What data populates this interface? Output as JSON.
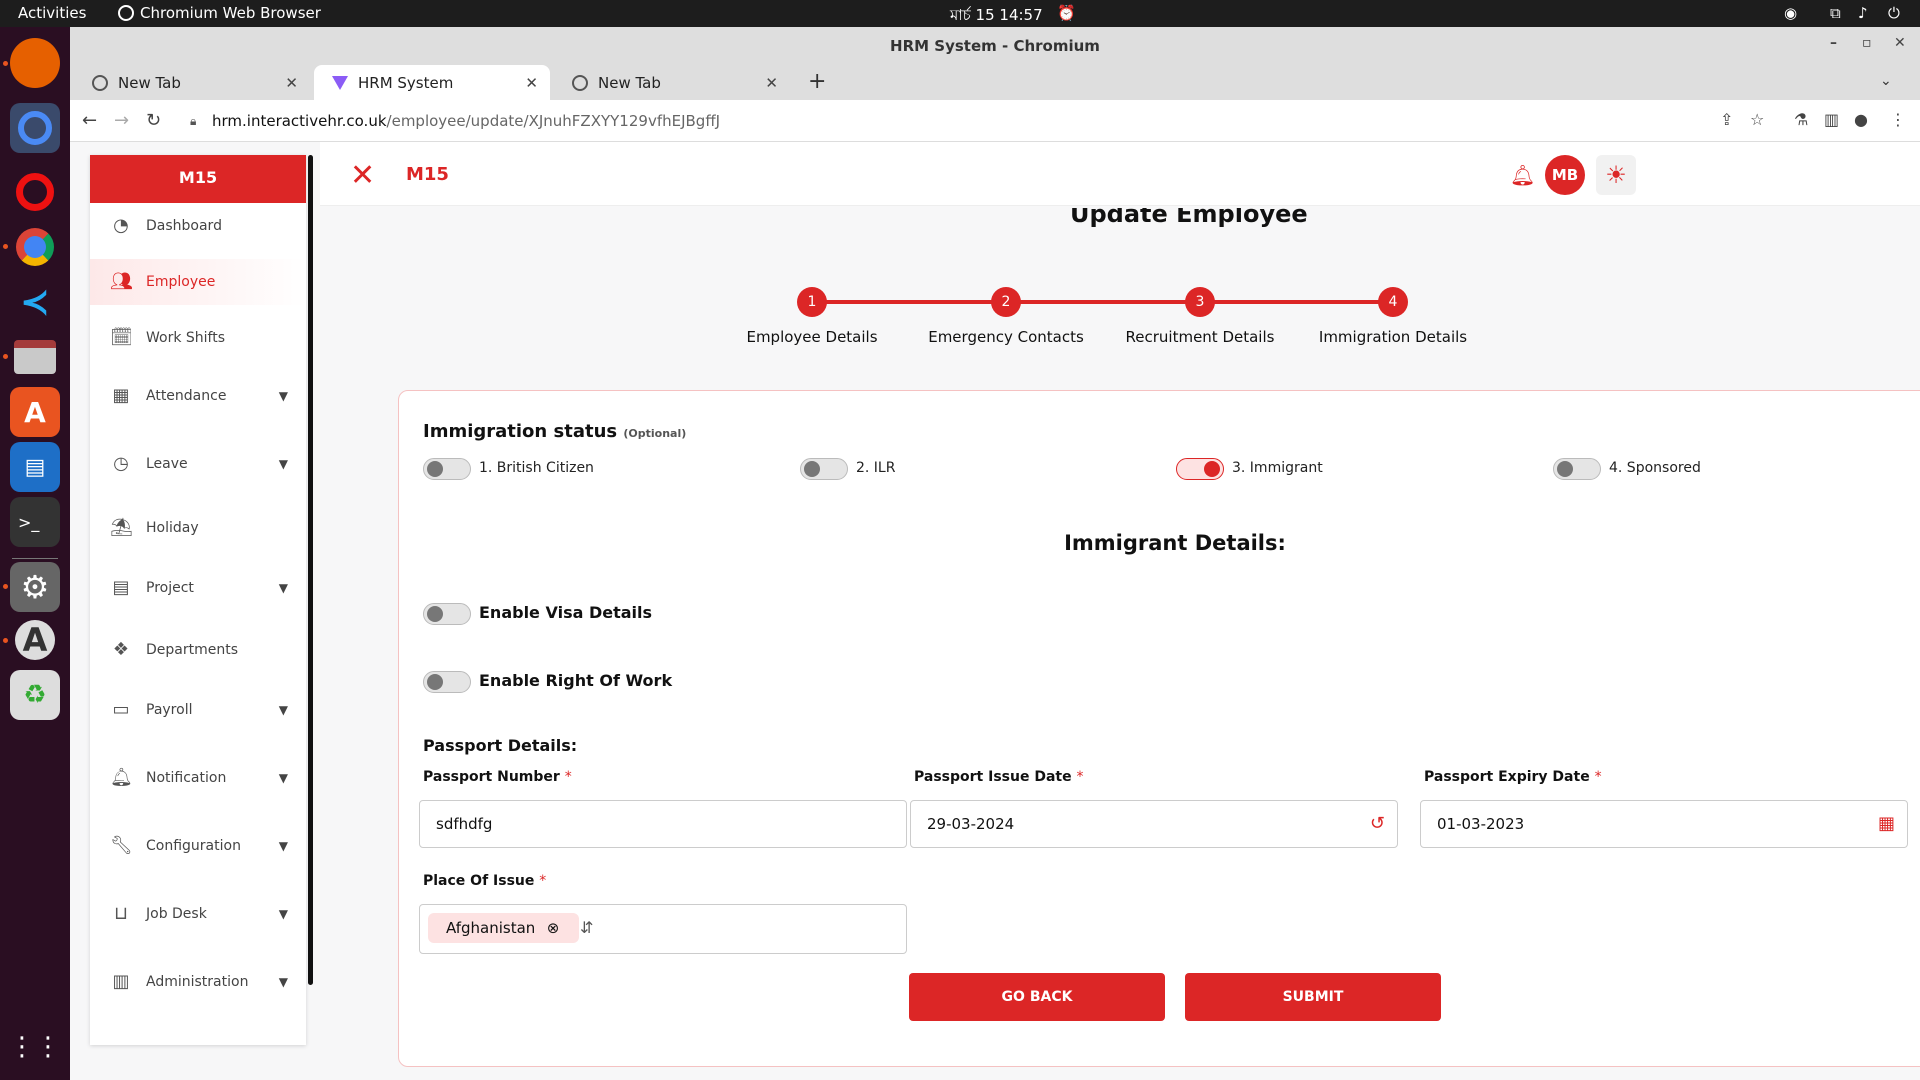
{
  "os": {
    "activities": "Activities",
    "app_name": "Chromium Web Browser",
    "clock": "মার্চ 15  14:57"
  },
  "window": {
    "title": "HRM System - Chromium"
  },
  "tabs": [
    {
      "label": "New Tab"
    },
    {
      "label": "HRM System"
    },
    {
      "label": "New Tab"
    }
  ],
  "address": {
    "url_host": "hrm.interactivehr.co.uk",
    "url_path": "/employee/update/XJnuhFZXYY129vfhEJBgffJ"
  },
  "sidebar": {
    "brand": "M15",
    "items": [
      {
        "label": "Dashboard",
        "icon": "pie-chart-icon"
      },
      {
        "label": "Employee",
        "icon": "users-icon"
      },
      {
        "label": "Work Shifts",
        "icon": "calendar-clock-icon"
      },
      {
        "label": "Attendance",
        "icon": "calendar-icon"
      },
      {
        "label": "Leave",
        "icon": "clock-icon"
      },
      {
        "label": "Holiday",
        "icon": "beach-icon"
      },
      {
        "label": "Project",
        "icon": "document-icon"
      },
      {
        "label": "Departments",
        "icon": "cubes-icon"
      },
      {
        "label": "Payroll",
        "icon": "card-icon"
      },
      {
        "label": "Notification",
        "icon": "bell-icon"
      },
      {
        "label": "Configuration",
        "icon": "wrench-icon"
      },
      {
        "label": "Job Desk",
        "icon": "inbox-icon"
      },
      {
        "label": "Administration",
        "icon": "building-icon"
      }
    ]
  },
  "header": {
    "brand": "M15",
    "avatar": "MB"
  },
  "page": {
    "title": "Update Employee"
  },
  "stepper": [
    {
      "num": "1",
      "label": "Employee Details"
    },
    {
      "num": "2",
      "label": "Emergency Contacts"
    },
    {
      "num": "3",
      "label": "Recruitment Details"
    },
    {
      "num": "4",
      "label": "Immigration Details"
    }
  ],
  "immigration": {
    "title": "Immigration status",
    "optional": "(Optional)",
    "options": [
      {
        "label": "1. British Citizen",
        "on": false
      },
      {
        "label": "2. ILR",
        "on": false
      },
      {
        "label": "3. Immigrant",
        "on": true
      },
      {
        "label": "4. Sponsored",
        "on": false
      }
    ],
    "details_title": "Immigrant Details:",
    "visa_label": "Enable Visa Details",
    "row_label": "Enable Right Of Work"
  },
  "passport": {
    "title": "Passport Details:",
    "number_label": "Passport Number",
    "number_value": "sdfhdfg",
    "issue_label": "Passport Issue Date",
    "issue_value": "29-03-2024",
    "expiry_label": "Passport Expiry Date",
    "expiry_value": "01-03-2023",
    "place_label": "Place Of Issue",
    "place_value": "Afghanistan",
    "required_mark": "*"
  },
  "buttons": {
    "back": "GO BACK",
    "submit": "SUBMIT"
  },
  "colors": {
    "accent": "#dc2626"
  }
}
